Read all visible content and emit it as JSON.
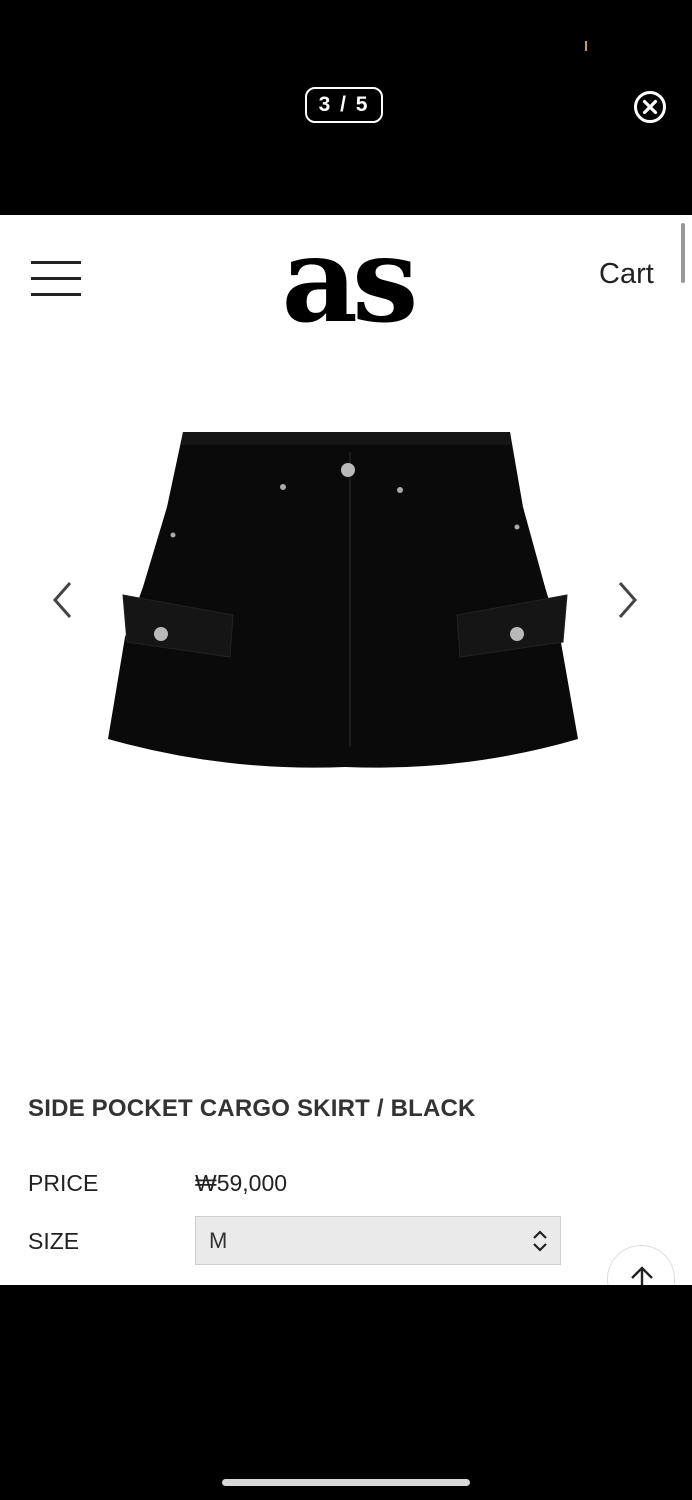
{
  "viewer": {
    "counter": "3 / 5",
    "close_icon": "close-circle-icon"
  },
  "header": {
    "menu_icon": "hamburger-icon",
    "logo_text": "as",
    "cart_label": "Cart"
  },
  "gallery": {
    "prev_icon": "chevron-left-icon",
    "next_icon": "chevron-right-icon"
  },
  "product": {
    "title": "SIDE POCKET CARGO SKIRT / BLACK",
    "price_label": "PRICE",
    "price_value": "₩59,000",
    "size_label": "SIZE",
    "size_selected": "M"
  },
  "controls": {
    "scroll_top_icon": "arrow-up-icon"
  }
}
